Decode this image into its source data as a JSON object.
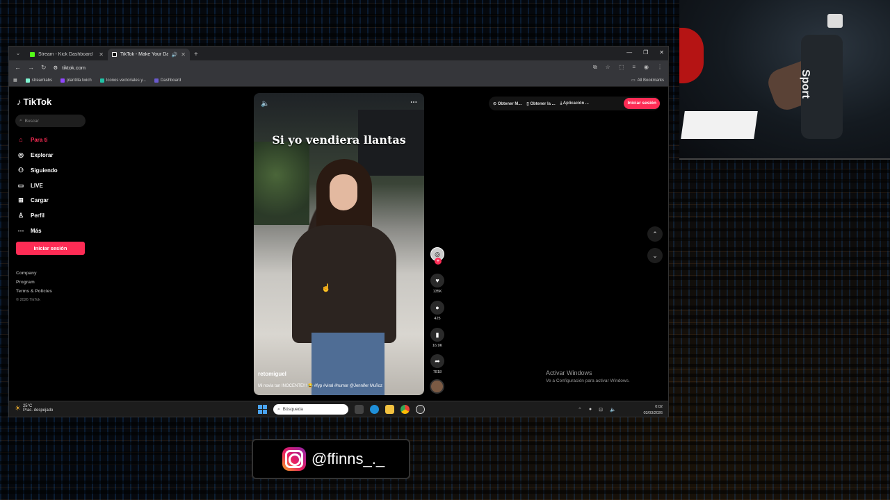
{
  "browser": {
    "tabs": [
      {
        "label": "Stream - Kick Dashboard",
        "active": false,
        "favicon_color": "#53fc18"
      },
      {
        "label": "TikTok - Make Your Day",
        "active": true,
        "favicon_color": "#000000"
      }
    ],
    "url": "tiktok.com",
    "bookmarks": [
      {
        "label": "streamlabs",
        "color": "#80f5d2"
      },
      {
        "label": "plantilla twich",
        "color": "#9146ff"
      },
      {
        "label": "Iconos vectoriales y...",
        "color": "#21c1a5"
      },
      {
        "label": "Dashboard",
        "color": "#6a5acd"
      }
    ],
    "all_bookmarks": "All Bookmarks"
  },
  "tiktok": {
    "logo": "TikTok",
    "search_placeholder": "Buscar",
    "nav": [
      {
        "label": "Para ti",
        "icon": "home-icon",
        "active": true
      },
      {
        "label": "Explorar",
        "icon": "compass-icon",
        "active": false
      },
      {
        "label": "Siguiendo",
        "icon": "following-icon",
        "active": false
      },
      {
        "label": "LIVE",
        "icon": "live-icon",
        "active": false
      },
      {
        "label": "Cargar",
        "icon": "upload-icon",
        "active": false
      },
      {
        "label": "Perfil",
        "icon": "profile-icon",
        "active": false
      },
      {
        "label": "Más",
        "icon": "more-icon",
        "active": false
      }
    ],
    "login_label": "Iniciar sesión",
    "footer": [
      "Company",
      "Program",
      "Terms & Policies"
    ],
    "copyright": "© 2026 TikTok",
    "topbar": {
      "items": [
        "Obtener M...",
        "Obtener la ...",
        "Aplicación ..."
      ],
      "signin": "Iniciar sesión"
    },
    "video": {
      "caption": "Si yo vendiera llantas",
      "author": "retomiguel",
      "description": "Mi novia tan INOCENTE!!! 😂 #fyp #viral #humor @Jennifer Muñoz"
    },
    "actions": {
      "likes": "135K",
      "comments": "425",
      "saves": "16.9K",
      "shares": "7818"
    },
    "activate": {
      "title": "Activar Windows",
      "subtitle": "Ve a Configuración para activar Windows."
    }
  },
  "taskbar": {
    "weather_temp": "25°C",
    "weather_desc": "Prac. despejado",
    "search_placeholder": "Búsqueda",
    "time": "0:02",
    "date": "03/03/2026"
  },
  "overlay": {
    "instagram_handle": "@ffinns_._"
  },
  "colors": {
    "accent": "#fe2c55",
    "taskbar": "#1c1c1c"
  }
}
